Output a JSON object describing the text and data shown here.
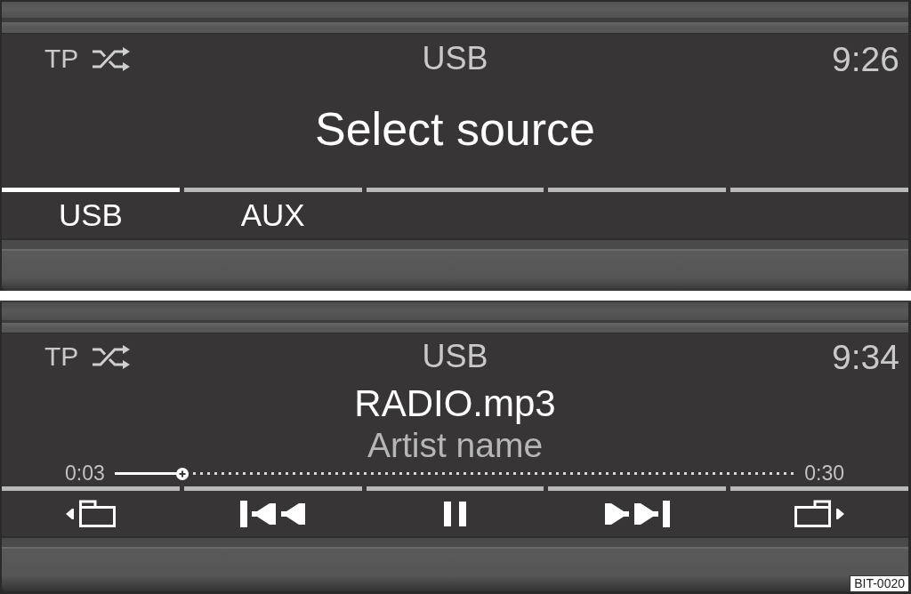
{
  "screens": [
    {
      "kind": "source_select",
      "status_bar": {
        "indicator": "TP",
        "shuffle": true,
        "source": "USB",
        "time": "9:26"
      },
      "title": "Select source",
      "tabs": [
        {
          "label": "USB",
          "selected": true
        },
        {
          "label": "AUX",
          "selected": false
        },
        {
          "selected": false
        },
        {
          "selected": false
        },
        {
          "selected": false
        }
      ]
    },
    {
      "kind": "player",
      "status_bar": {
        "indicator": "TP",
        "shuffle": true,
        "source": "USB",
        "time": "9:34"
      },
      "track": {
        "title": "RADIO.mp3",
        "artist": "Artist name"
      },
      "progress": {
        "elapsed": "0:03",
        "total": "0:30",
        "level": 0.1
      },
      "controls": [
        {
          "kind": "previous_folder"
        },
        {
          "kind": "previous_track"
        },
        {
          "kind": "pause"
        },
        {
          "kind": "next_track"
        },
        {
          "kind": "next_folder"
        }
      ]
    }
  ],
  "figure_label": "BIT-0020"
}
